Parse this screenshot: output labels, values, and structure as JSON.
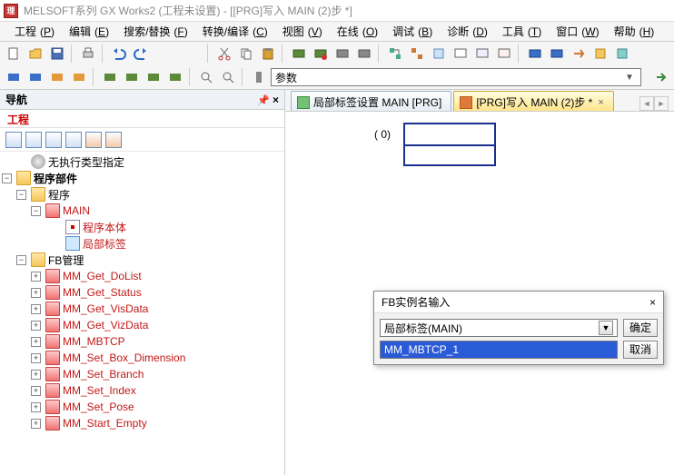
{
  "titlebar": {
    "app_badge": "理",
    "text": "MELSOFT系列 GX Works2 (工程未设置) - [[PRG]写入 MAIN (2)步 *]"
  },
  "menu": {
    "items": [
      {
        "label": "工程",
        "acc": "P"
      },
      {
        "label": "编辑",
        "acc": "E"
      },
      {
        "label": "搜索/替换",
        "acc": "F"
      },
      {
        "label": "转换/编译",
        "acc": "C"
      },
      {
        "label": "视图",
        "acc": "V"
      },
      {
        "label": "在线",
        "acc": "O"
      },
      {
        "label": "调试",
        "acc": "B"
      },
      {
        "label": "诊断",
        "acc": "D"
      },
      {
        "label": "工具",
        "acc": "T"
      },
      {
        "label": "窗口",
        "acc": "W"
      },
      {
        "label": "帮助",
        "acc": "H"
      }
    ]
  },
  "toolbar2": {
    "combo_label": "参数"
  },
  "nav": {
    "header": "导航",
    "section": "工程",
    "tree": {
      "root_noexec": "无执行类型指定",
      "prog_parts": "程序部件",
      "program": "程序",
      "main": "MAIN",
      "prog_body": "程序本体",
      "local_label": "局部标签",
      "fb_mgmt": "FB管理",
      "fb_items": [
        "MM_Get_DoList",
        "MM_Get_Status",
        "MM_Get_VisData",
        "MM_Get_VizData",
        "MM_MBTCP",
        "MM_Set_Box_Dimension",
        "MM_Set_Branch",
        "MM_Set_Index",
        "MM_Set_Pose",
        "MM_Start_Empty"
      ]
    }
  },
  "tabs": {
    "t1": "局部标签设置 MAIN [PRG]",
    "t2": "[PRG]写入 MAIN (2)步 *"
  },
  "ladder": {
    "step_num": "(     0)"
  },
  "fb_dialog": {
    "title": "FB实例名输入",
    "select_value": "局部标签(MAIN)",
    "input_value": "MM_MBTCP_1",
    "ok": "确定",
    "cancel": "取消",
    "close": "×"
  }
}
